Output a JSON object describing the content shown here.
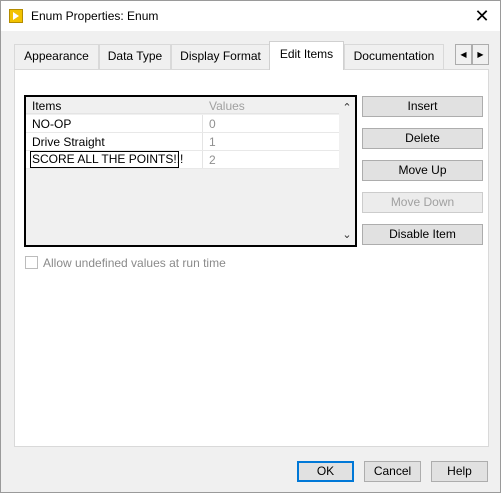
{
  "window": {
    "title": "Enum Properties: Enum",
    "close_glyph": "✕",
    "icon": "labview-vi-icon"
  },
  "tabs": [
    {
      "label": "Appearance",
      "active": false
    },
    {
      "label": "Data Type",
      "active": false
    },
    {
      "label": "Display Format",
      "active": false
    },
    {
      "label": "Edit Items",
      "active": true
    },
    {
      "label": "Documentation",
      "active": false
    }
  ],
  "tab_scroll": {
    "left": "◀",
    "right": "▶"
  },
  "list": {
    "header_items": "Items",
    "header_values": "Values",
    "rows": [
      {
        "item": "NO-OP",
        "value": "0"
      },
      {
        "item": "Drive Straight",
        "value": "1"
      },
      {
        "item": "SCORE ALL THE POINTS!!!",
        "value": "2"
      }
    ],
    "scroll_up": "⌃",
    "scroll_down": "⌄"
  },
  "buttons": {
    "insert": "Insert",
    "delete": "Delete",
    "move_up": "Move Up",
    "move_down": "Move Down",
    "disable_item": "Disable Item"
  },
  "checkbox": {
    "label": "Allow undefined values at run time",
    "checked": false
  },
  "dialog_buttons": {
    "ok": "OK",
    "cancel": "Cancel",
    "help": "Help"
  }
}
